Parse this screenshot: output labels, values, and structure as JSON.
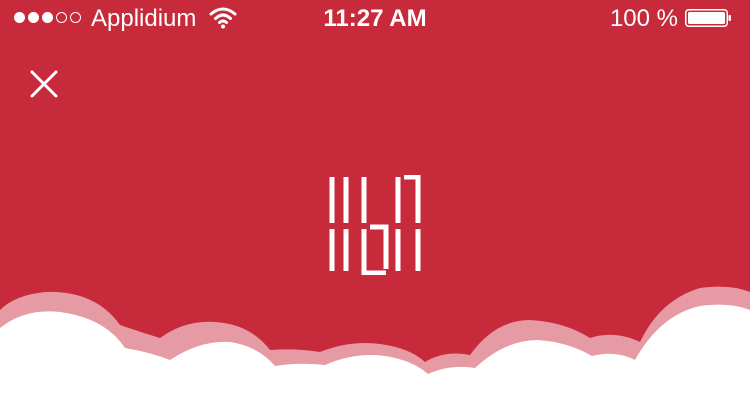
{
  "status_bar": {
    "signal_bars": {
      "filled": 3,
      "total": 5
    },
    "carrier": "Applidium",
    "wifi_icon": "wifi-icon",
    "time": "11:27 AM",
    "battery_percent": "100 %",
    "battery_level": 1.0
  },
  "close_button": {
    "icon": "close-icon"
  },
  "logo": {
    "icon": "app-logo-icon"
  },
  "colors": {
    "background": "#c72a3a",
    "foreground": "#ffffff",
    "cloud_back": "#e69aa3",
    "cloud_front": "#ffffff"
  }
}
